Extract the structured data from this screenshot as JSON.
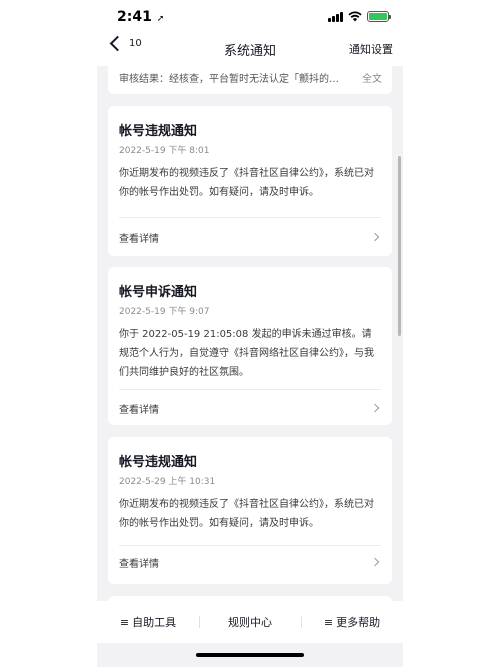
{
  "status_bar": {
    "time": "2:41",
    "battery_color": "#34c759",
    "icons": [
      "signal-icon",
      "wifi-icon",
      "battery-icon",
      "location-arrow-icon"
    ]
  },
  "nav": {
    "back_count": "10",
    "title": "系统通知",
    "right_label": "通知设置"
  },
  "partial_card": {
    "text": "审核结果：经核查，平台暂时无法认定「颤抖的…",
    "more": "全文"
  },
  "cards": [
    {
      "title": "帐号违规通知",
      "date": "2022-5-19 下午 8:01",
      "body": "你近期发布的视频违反了《抖音社区自律公约》，系统已对你的帐号作出处罚。如有疑问，请及时申诉。",
      "link": "查看详情"
    },
    {
      "title": "帐号申诉通知",
      "date": "2022-5-19 下午 9:07",
      "body": "你于 2022-05-19 21:05:08 发起的申诉未通过审核。请规范个人行为，自觉遵守《抖音网络社区自律公约》，与我们共同维护良好的社区氛围。",
      "link": "查看详情"
    },
    {
      "title": "帐号违规通知",
      "date": "2022-5-29 上午 10:31",
      "body": "你近期发布的视频违反了《抖音社区自律公约》，系统已对你的帐号作出处罚。如有疑问，请及时申诉。",
      "link": "查看详情"
    }
  ],
  "tab_bar": {
    "items": [
      {
        "icon": "≡",
        "label": "自助工具"
      },
      {
        "icon": "",
        "label": "规则中心"
      },
      {
        "icon": "≡",
        "label": "更多帮助"
      }
    ]
  }
}
